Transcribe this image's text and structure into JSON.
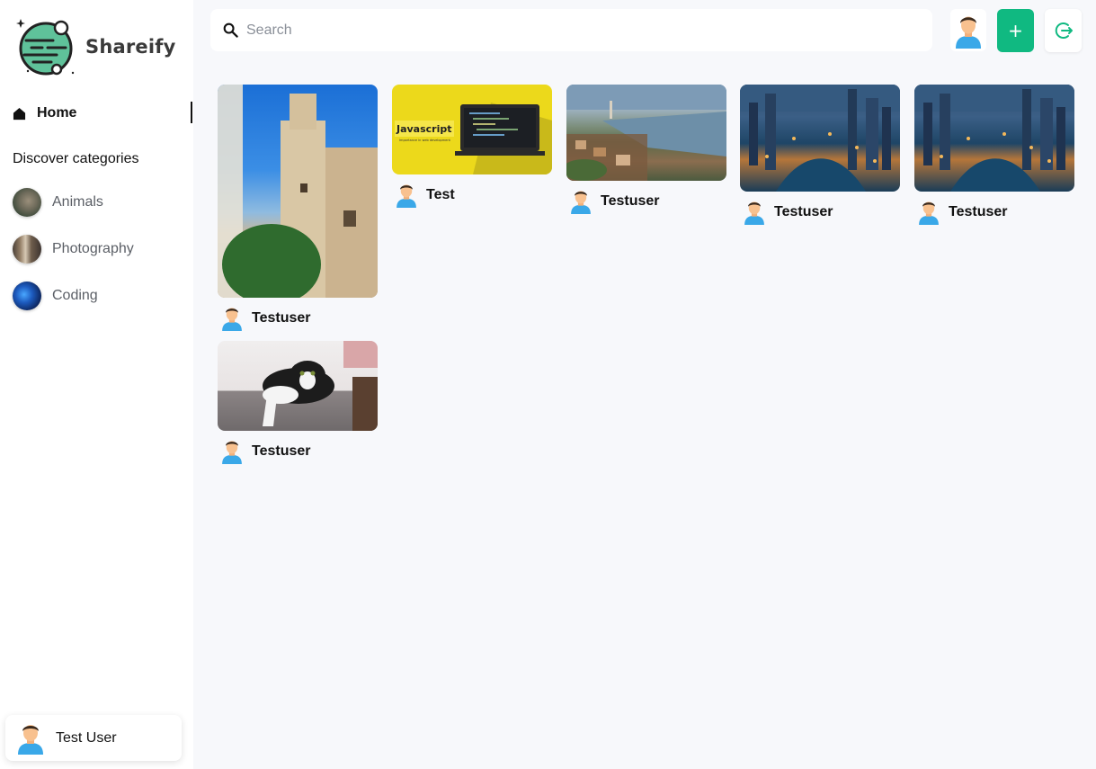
{
  "app": {
    "name": "Shareify"
  },
  "sidebar": {
    "home_label": "Home",
    "categories_heading": "Discover categories",
    "categories": [
      {
        "label": "Animals",
        "icon": "animals-thumbnail"
      },
      {
        "label": "Photography",
        "icon": "photography-thumbnail"
      },
      {
        "label": "Coding",
        "icon": "coding-thumbnail"
      }
    ],
    "user_name": "Test User"
  },
  "header": {
    "search_placeholder": "Search",
    "search_value": "",
    "add_label": "+",
    "icons": [
      "search-icon",
      "user-avatar-icon",
      "logout-icon"
    ]
  },
  "pins": [
    {
      "author": "Testuser",
      "image": "minaret-tower-photo"
    },
    {
      "author": "Test",
      "image": "javascript-laptop-banner",
      "image_text_title": "Javascript",
      "image_text_sub": "Importance in web development"
    },
    {
      "author": "Testuser",
      "image": "coastal-city-aerial-photo"
    },
    {
      "author": "Testuser",
      "image": "dubai-marina-night-photo"
    },
    {
      "author": "Testuser",
      "image": "dubai-marina-night-photo"
    },
    {
      "author": "Testuser",
      "image": "cat-on-sofa-photo"
    }
  ],
  "colors": {
    "accent_green": "#10b981",
    "background": "#f7f8fb",
    "js_yellow": "#ecd91b"
  }
}
